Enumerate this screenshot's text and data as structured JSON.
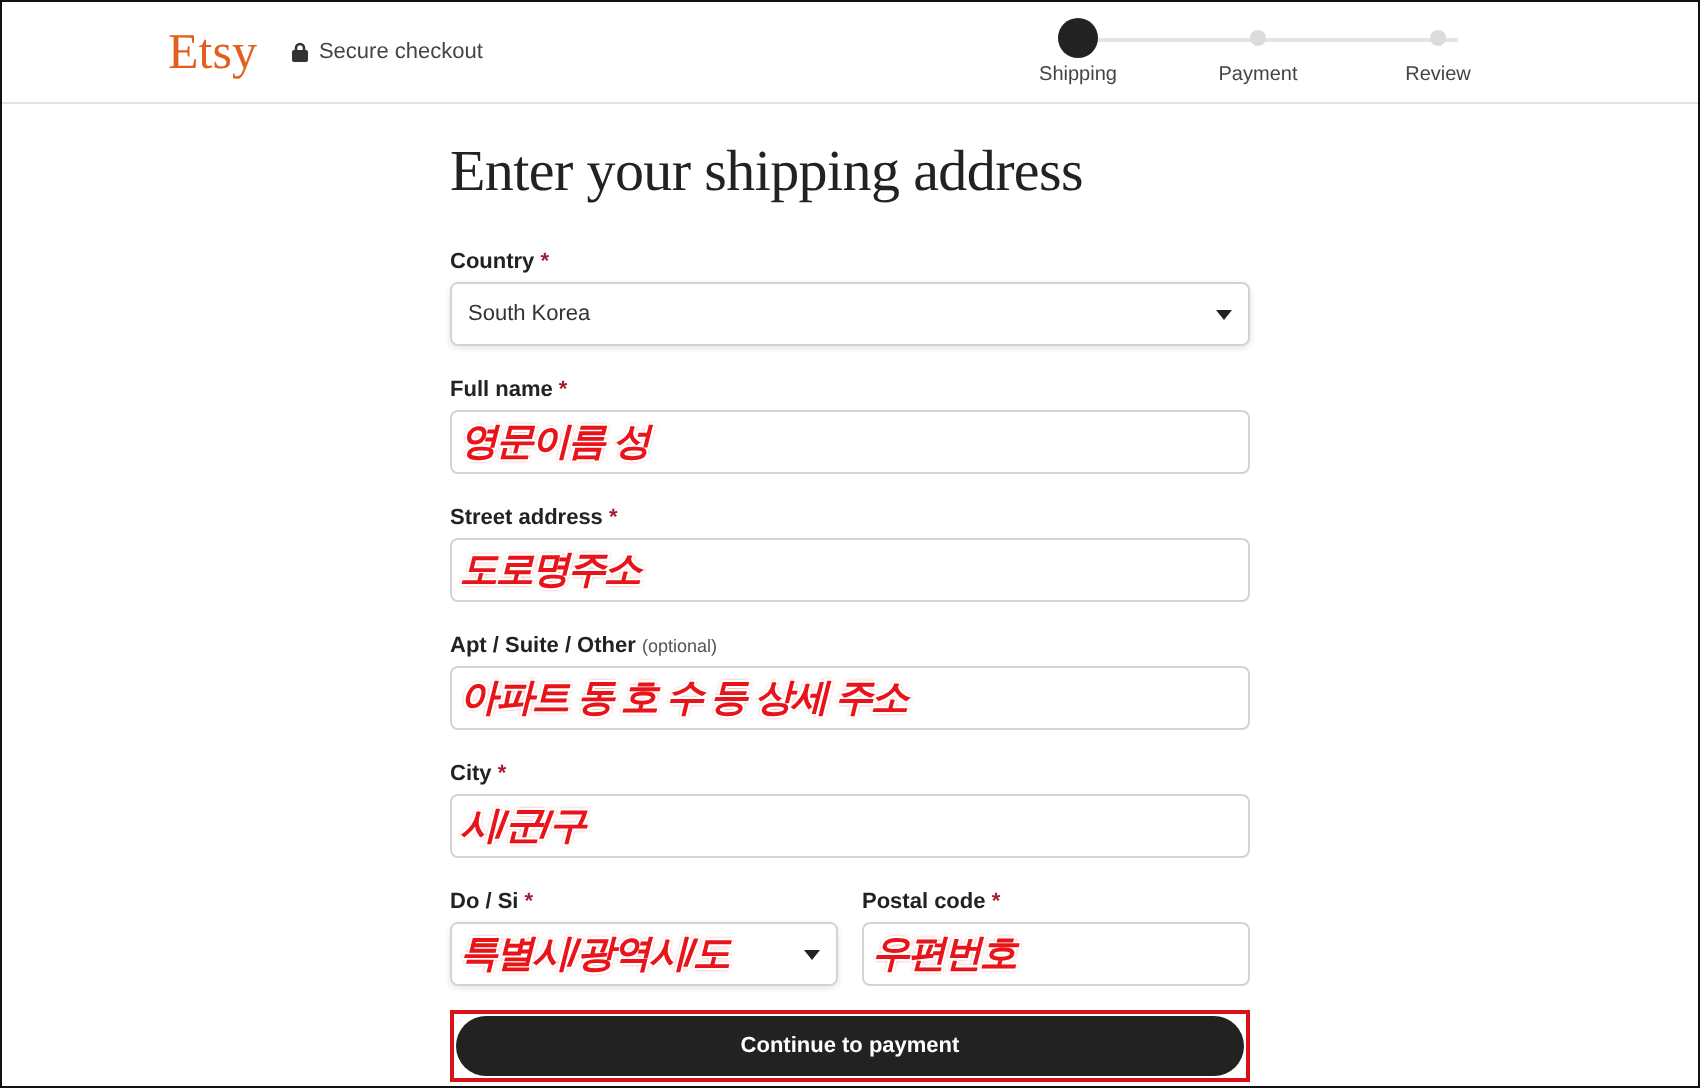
{
  "header": {
    "logo": "Etsy",
    "secure_label": "Secure checkout",
    "steps": [
      {
        "label": "Shipping",
        "selected": true
      },
      {
        "label": "Payment",
        "selected": false
      },
      {
        "label": "Review",
        "selected": false
      }
    ]
  },
  "form": {
    "title": "Enter your shipping address",
    "rows": [
      [
        {
          "kind": "select",
          "label": "Country",
          "required_mark": "*",
          "value": "South Korea",
          "annotated": false
        }
      ],
      [
        {
          "kind": "text",
          "label": "Full name",
          "required_mark": "*",
          "value": "영문이름 성",
          "annotated": true
        }
      ],
      [
        {
          "kind": "text",
          "label": "Street address",
          "required_mark": "*",
          "value": "도로명주소",
          "annotated": true
        }
      ],
      [
        {
          "kind": "text",
          "label": "Apt / Suite / Other",
          "note": "(optional)",
          "value": "아파트 동 호 수 등 상세 주소",
          "annotated": true
        }
      ],
      [
        {
          "kind": "text",
          "label": "City",
          "required_mark": "*",
          "value": "시/군/구",
          "annotated": true
        }
      ],
      [
        {
          "kind": "select",
          "label": "Do / Si",
          "required_mark": "*",
          "value": "특별시/광역시/도",
          "annotated": true
        },
        {
          "kind": "text",
          "label": "Postal code",
          "required_mark": "*",
          "value": "우편번호",
          "annotated": true
        }
      ]
    ],
    "submit": {
      "label": "Continue to payment",
      "highlighted": true
    }
  }
}
